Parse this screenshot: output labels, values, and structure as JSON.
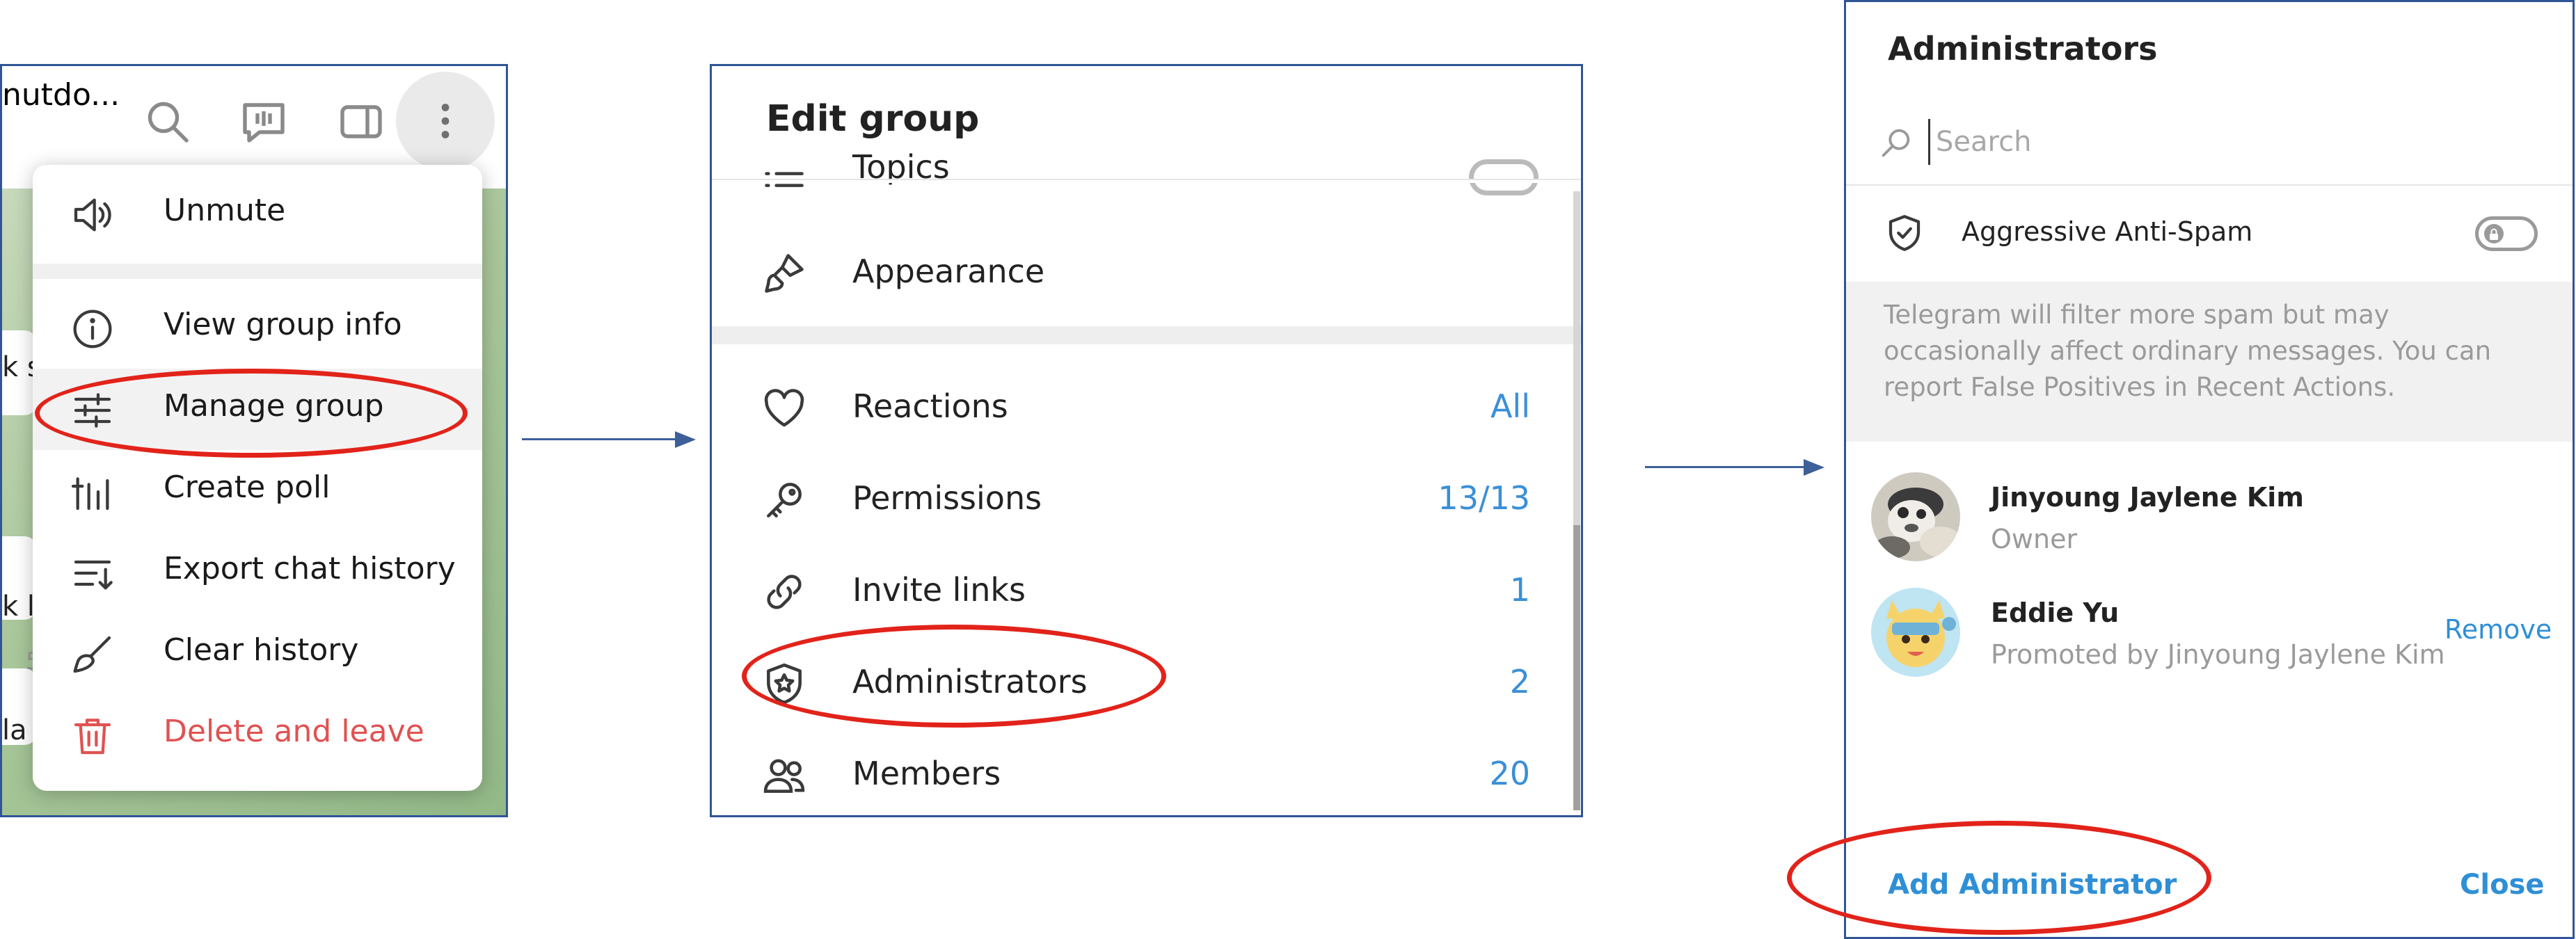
{
  "colors": {
    "panel_border": "#2f5597",
    "accent_blue": "#3a8fd8",
    "danger_red": "#e05252",
    "highlight_ring": "#e2231a",
    "arrow": "#3d5f9a"
  },
  "panel1": {
    "chat_title_truncated": "nutdo...",
    "header_icons": [
      "search-icon",
      "video-chat-icon",
      "sidebar-toggle-icon",
      "more-vertical-icon"
    ],
    "chat_fragments": [
      "k st",
      "k la",
      "5",
      "la"
    ],
    "menu": {
      "items": [
        {
          "label": "Unmute",
          "icon": "speaker-icon"
        },
        {
          "label": "View group info",
          "icon": "info-icon"
        },
        {
          "label": "Manage group",
          "icon": "sliders-icon"
        },
        {
          "label": "Create poll",
          "icon": "poll-icon"
        },
        {
          "label": "Export chat history",
          "icon": "export-icon"
        },
        {
          "label": "Clear history",
          "icon": "broom-icon"
        },
        {
          "label": "Delete and leave",
          "icon": "trash-icon"
        }
      ]
    }
  },
  "panel2": {
    "title": "Edit group",
    "rows": [
      {
        "label": "Topics",
        "icon": "list-icon",
        "value": ""
      },
      {
        "label": "Appearance",
        "icon": "brush-icon",
        "value": ""
      },
      {
        "label": "Reactions",
        "icon": "heart-icon",
        "value": "All"
      },
      {
        "label": "Permissions",
        "icon": "key-icon",
        "value": "13/13"
      },
      {
        "label": "Invite links",
        "icon": "link-icon",
        "value": "1"
      },
      {
        "label": "Administrators",
        "icon": "admin-shield-icon",
        "value": "2"
      },
      {
        "label": "Members",
        "icon": "members-icon",
        "value": "20"
      }
    ]
  },
  "panel3": {
    "title": "Administrators",
    "search_placeholder": "Search",
    "anti_spam_label": "Aggressive Anti-Spam",
    "anti_spam_note": "Telegram will filter more spam but may occasionally affect ordinary messages. You can report False Positives in Recent Actions.",
    "members": [
      {
        "name": "Jinyoung Jaylene Kim",
        "role": "Owner"
      },
      {
        "name": "Eddie Yu",
        "role": "Promoted by Jinyoung Jaylene Kim",
        "action": "Remove"
      }
    ],
    "add_button": "Add Administrator",
    "close_button": "Close"
  }
}
